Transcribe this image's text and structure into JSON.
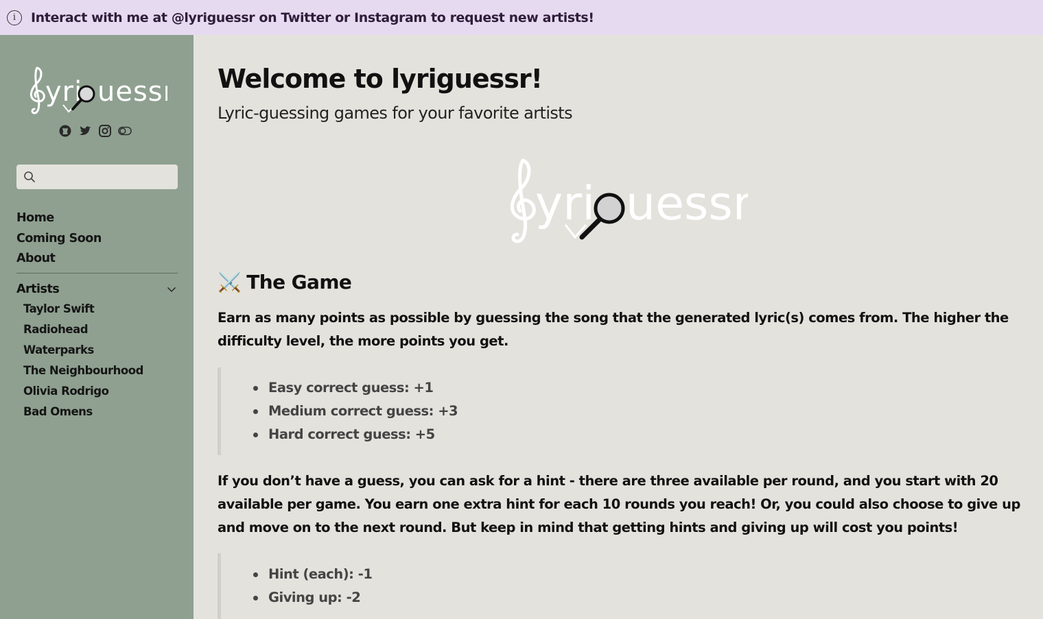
{
  "banner": {
    "text": "Interact with me at @lyriguessr on Twitter or Instagram to request new artists!",
    "icon": "info-icon"
  },
  "sidebar": {
    "logo": {
      "text": "lyriguessr"
    },
    "social_icons": [
      "github-icon",
      "twitter-icon",
      "instagram-icon",
      "theme-toggle-icon"
    ],
    "search": {
      "placeholder": ""
    },
    "nav": [
      "Home",
      "Coming Soon",
      "About"
    ],
    "artists_label": "Artists",
    "artists": [
      "Taylor Swift",
      "Radiohead",
      "Waterparks",
      "The Neighbourhood",
      "Olivia Rodrigo",
      "Bad Omens"
    ]
  },
  "main": {
    "title": "Welcome to lyriguessr!",
    "subtitle": "Lyric-guessing games for your favorite artists",
    "section_icon": "⚔️",
    "section_title": "The Game",
    "para1": "Earn as many points as possible by guessing the song that the generated lyric(s) comes from. The higher the difficulty level, the more points you get.",
    "points": [
      "Easy correct guess: +1",
      "Medium correct guess: +3",
      "Hard correct guess: +5"
    ],
    "para2": "If you don’t have a guess, you can ask for a hint - there are three available per round, and you start with 20 available per game. You earn one extra hint for each 10 rounds you reach! Or, you could also choose to give up and move on to the next round. But keep in mind that getting hints and giving up will cost you points!",
    "penalties": [
      "Hint (each): -1",
      "Giving up: -2"
    ]
  },
  "colors": {
    "banner_bg": "#e6daf0",
    "sidebar_bg": "#8fa090",
    "main_bg": "#e4e2dc"
  }
}
